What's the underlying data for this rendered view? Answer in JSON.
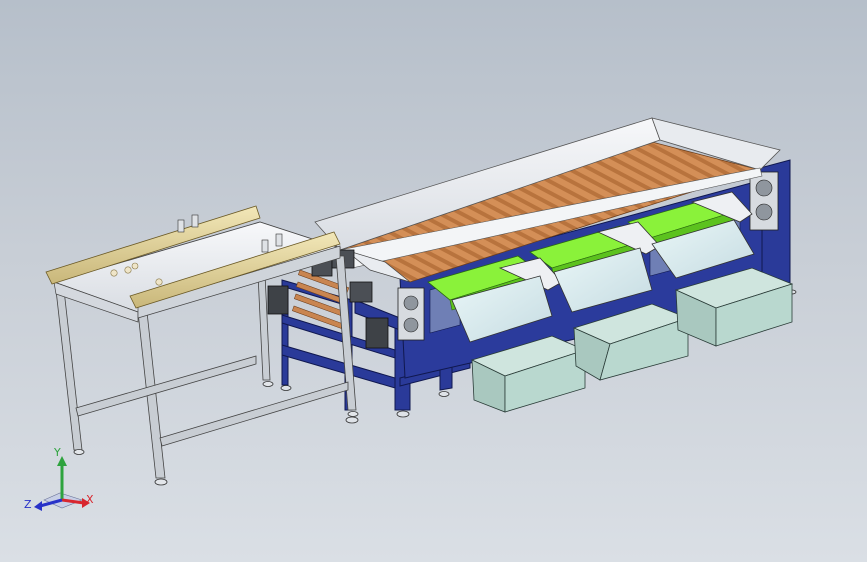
{
  "triad": {
    "x_label": "X",
    "y_label": "Y",
    "z_label": "Z"
  },
  "colors": {
    "frame_blue": "#24338f",
    "frame_blue_dark": "#162068",
    "roller_orange": "#c9824a",
    "belt_green": "#8af23a",
    "bin_teal": "#b9d8cf",
    "steel": "#b9bfc6",
    "white_panel": "#eef0f3",
    "axis_x": "#d8262e",
    "axis_y": "#2ea33e",
    "axis_z": "#2832c8"
  }
}
